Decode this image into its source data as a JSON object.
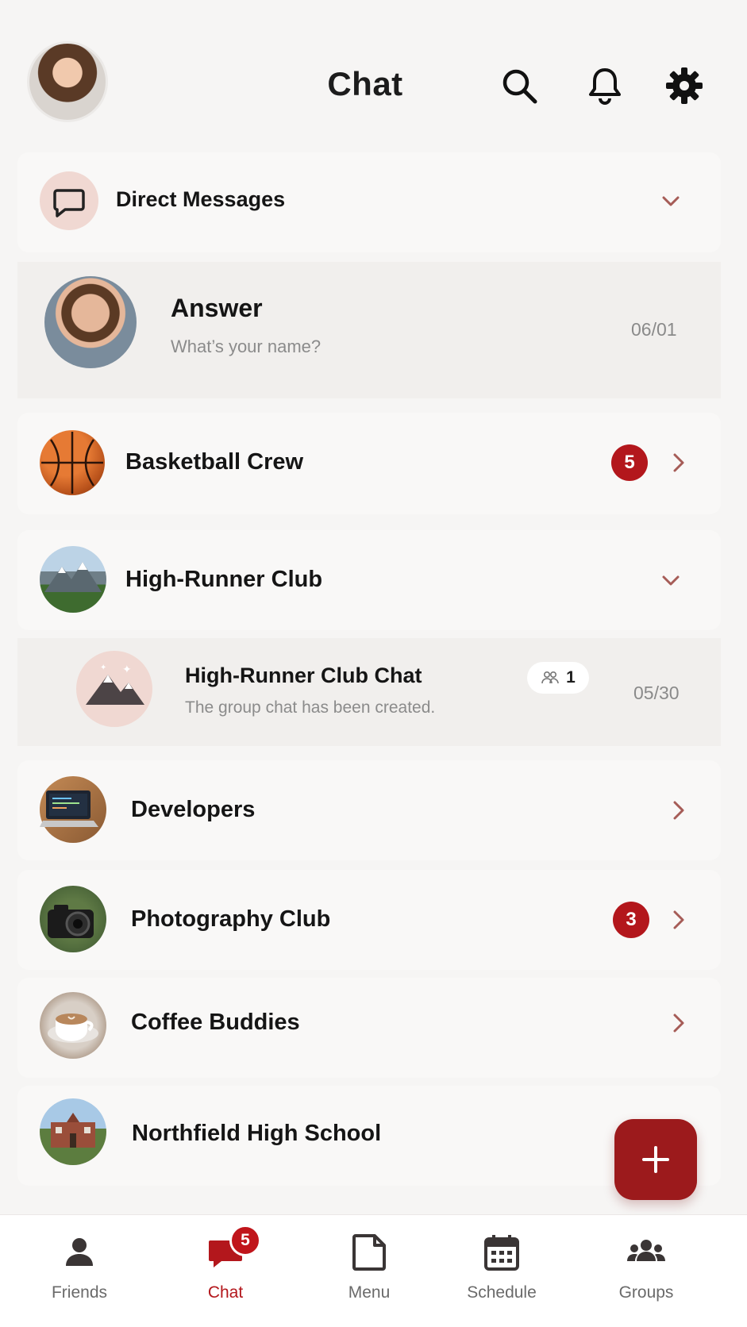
{
  "header": {
    "title": "Chat"
  },
  "icons": {
    "search": "search-icon",
    "bell": "bell-icon",
    "settings": "gear-icon"
  },
  "direct_messages": {
    "label": "Direct Messages",
    "item": {
      "name": "Answer",
      "preview": "What’s your name?",
      "date": "06/01"
    }
  },
  "groups": [
    {
      "name": "Basketball Crew",
      "badge": "5"
    },
    {
      "name": "High-Runner Club"
    },
    {
      "name": "Developers"
    },
    {
      "name": "Photography Club",
      "badge": "3"
    },
    {
      "name": "Coffee Buddies"
    },
    {
      "name": "Northfield High School"
    }
  ],
  "high_runner_chat": {
    "name": "High-Runner Club Chat",
    "preview": "The group chat has been created.",
    "members": "1",
    "date": "05/30"
  },
  "tabbar": {
    "friends": "Friends",
    "chat": "Chat",
    "chat_badge": "5",
    "menu": "Menu",
    "schedule": "Schedule",
    "groups": "Groups"
  },
  "colors": {
    "accent": "#b3171c",
    "fab": "#9c1a1c",
    "background": "#f6f5f4"
  }
}
